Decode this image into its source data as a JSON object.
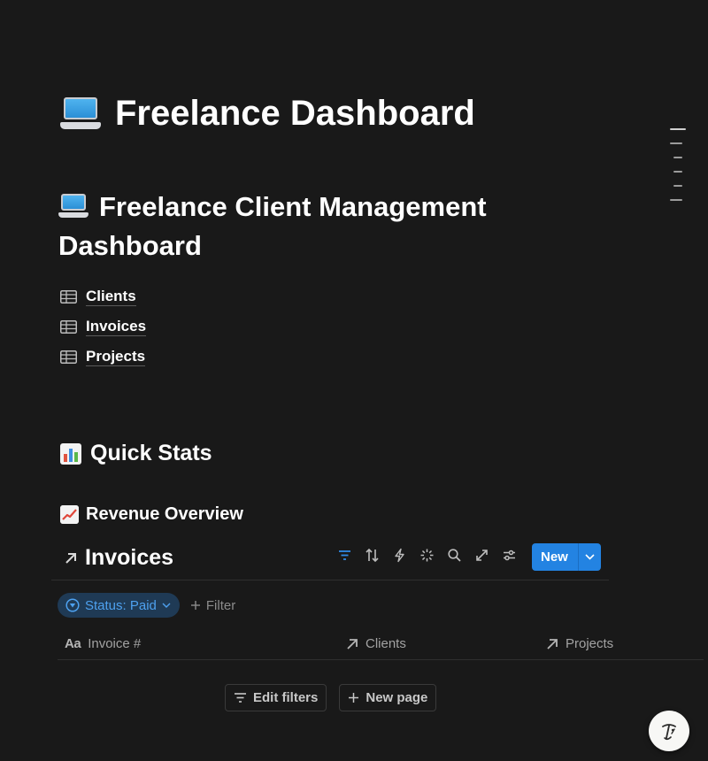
{
  "page": {
    "title": "Freelance Dashboard",
    "heading": "Freelance Client Management Dashboard"
  },
  "databases": [
    {
      "label": "Clients",
      "icon": "table-icon"
    },
    {
      "label": "Invoices",
      "icon": "table-icon"
    },
    {
      "label": "Projects",
      "icon": "table-icon"
    }
  ],
  "sections": {
    "quick_stats": "Quick Stats",
    "revenue_overview": "Revenue Overview"
  },
  "view": {
    "title": "Invoices",
    "toolbar": [
      "filter-icon",
      "sort-icon",
      "automation-icon",
      "ai-sparkle-icon",
      "search-icon",
      "expand-icon",
      "settings-icon"
    ],
    "new_label": "New",
    "filter_chip": "Status: Paid",
    "add_filter": "Filter",
    "columns": [
      {
        "label": "Invoice #",
        "icon": "title-aa-icon"
      },
      {
        "label": "Clients",
        "icon": "relation-arrow-icon"
      },
      {
        "label": "Projects",
        "icon": "relation-arrow-icon"
      }
    ],
    "edit_filters": "Edit filters",
    "new_page": "New page"
  },
  "colors": {
    "background": "#191919",
    "accent": "#2383e2",
    "chip_bg": "#1f3a55",
    "chip_text": "#4ea1ef"
  }
}
